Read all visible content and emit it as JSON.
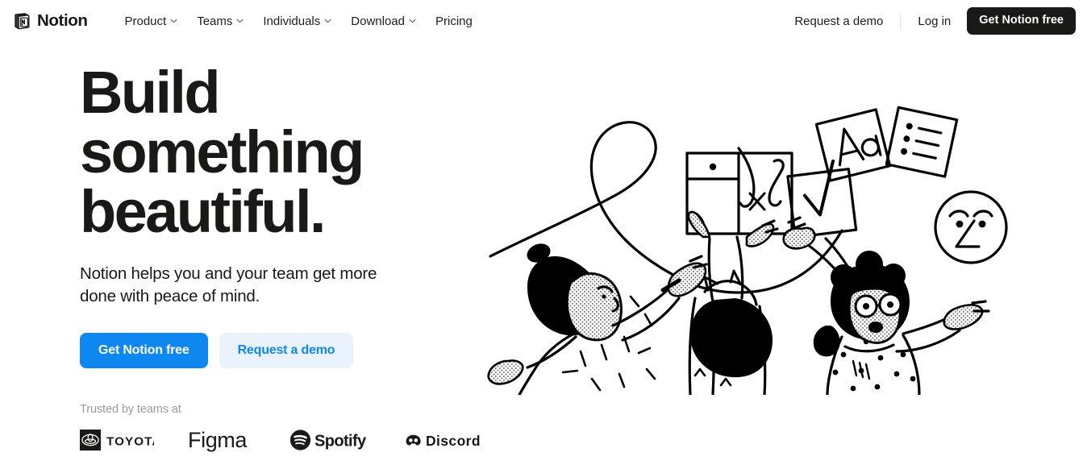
{
  "brand": {
    "name": "Notion",
    "logo_icon": "notion-notebook-logo"
  },
  "header": {
    "nav_items": [
      {
        "label": "Product",
        "has_dropdown": true,
        "icon": "chevron-down-icon"
      },
      {
        "label": "Teams",
        "has_dropdown": true,
        "icon": "chevron-down-icon"
      },
      {
        "label": "Individuals",
        "has_dropdown": true,
        "icon": "chevron-down-icon"
      },
      {
        "label": "Download",
        "has_dropdown": true,
        "icon": "chevron-down-icon"
      },
      {
        "label": "Pricing",
        "has_dropdown": false,
        "icon": ""
      }
    ],
    "request_demo": "Request a demo",
    "login": "Log in",
    "cta": "Get Notion free"
  },
  "hero": {
    "headline": "Build\nsomething\nbeautiful.",
    "subheadline": "Notion helps you and your team get more\ndone with peace of mind.",
    "primary_cta": "Get Notion free",
    "secondary_cta": "Request a demo",
    "trusted_label": "Trusted by teams at",
    "logos": [
      {
        "name": "Toyota",
        "icon": "toyota-logo"
      },
      {
        "name": "Figma",
        "icon": "figma-logo"
      },
      {
        "name": "Spotify",
        "icon": "spotify-logo"
      },
      {
        "name": "Discord",
        "icon": "discord-logo"
      }
    ],
    "illustration": {
      "name": "hero-illustration-three-people-building",
      "elements": [
        "person-drawing-loop-with-pen",
        "person-holding-table-grid-panel",
        "person-with-glasses-arms-raised",
        "card-checkmark",
        "card-aa-typography",
        "card-bulleted-list",
        "circle-face-emoji"
      ]
    }
  },
  "colors": {
    "accent_blue": "#0e87f0",
    "accent_blue_soft": "#eaf3fd",
    "text_dark": "#191918",
    "text_muted": "#9b9a97",
    "background": "#ffffff",
    "dark_button": "#191918"
  }
}
